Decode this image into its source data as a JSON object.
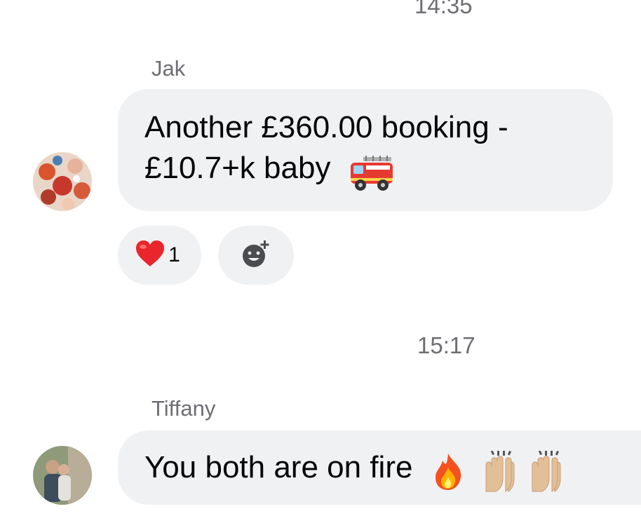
{
  "timestamps": {
    "top": "14:35",
    "middle": "15:17"
  },
  "messages": [
    {
      "sender": "Jak",
      "line1": "Another £360.00 booking -",
      "line2": "£10.7+k baby",
      "emoji": "fire-engine-icon",
      "reaction_count": "1"
    },
    {
      "sender": "Tiffany",
      "text": "You both are on fire",
      "emoji": [
        "fire-icon",
        "raising-hands-icon",
        "raising-hands-icon"
      ]
    }
  ],
  "colors": {
    "bubble": "#f0f1f3",
    "meta_text": "#6e6e73",
    "text": "#050505",
    "heart": "#e8262c"
  }
}
